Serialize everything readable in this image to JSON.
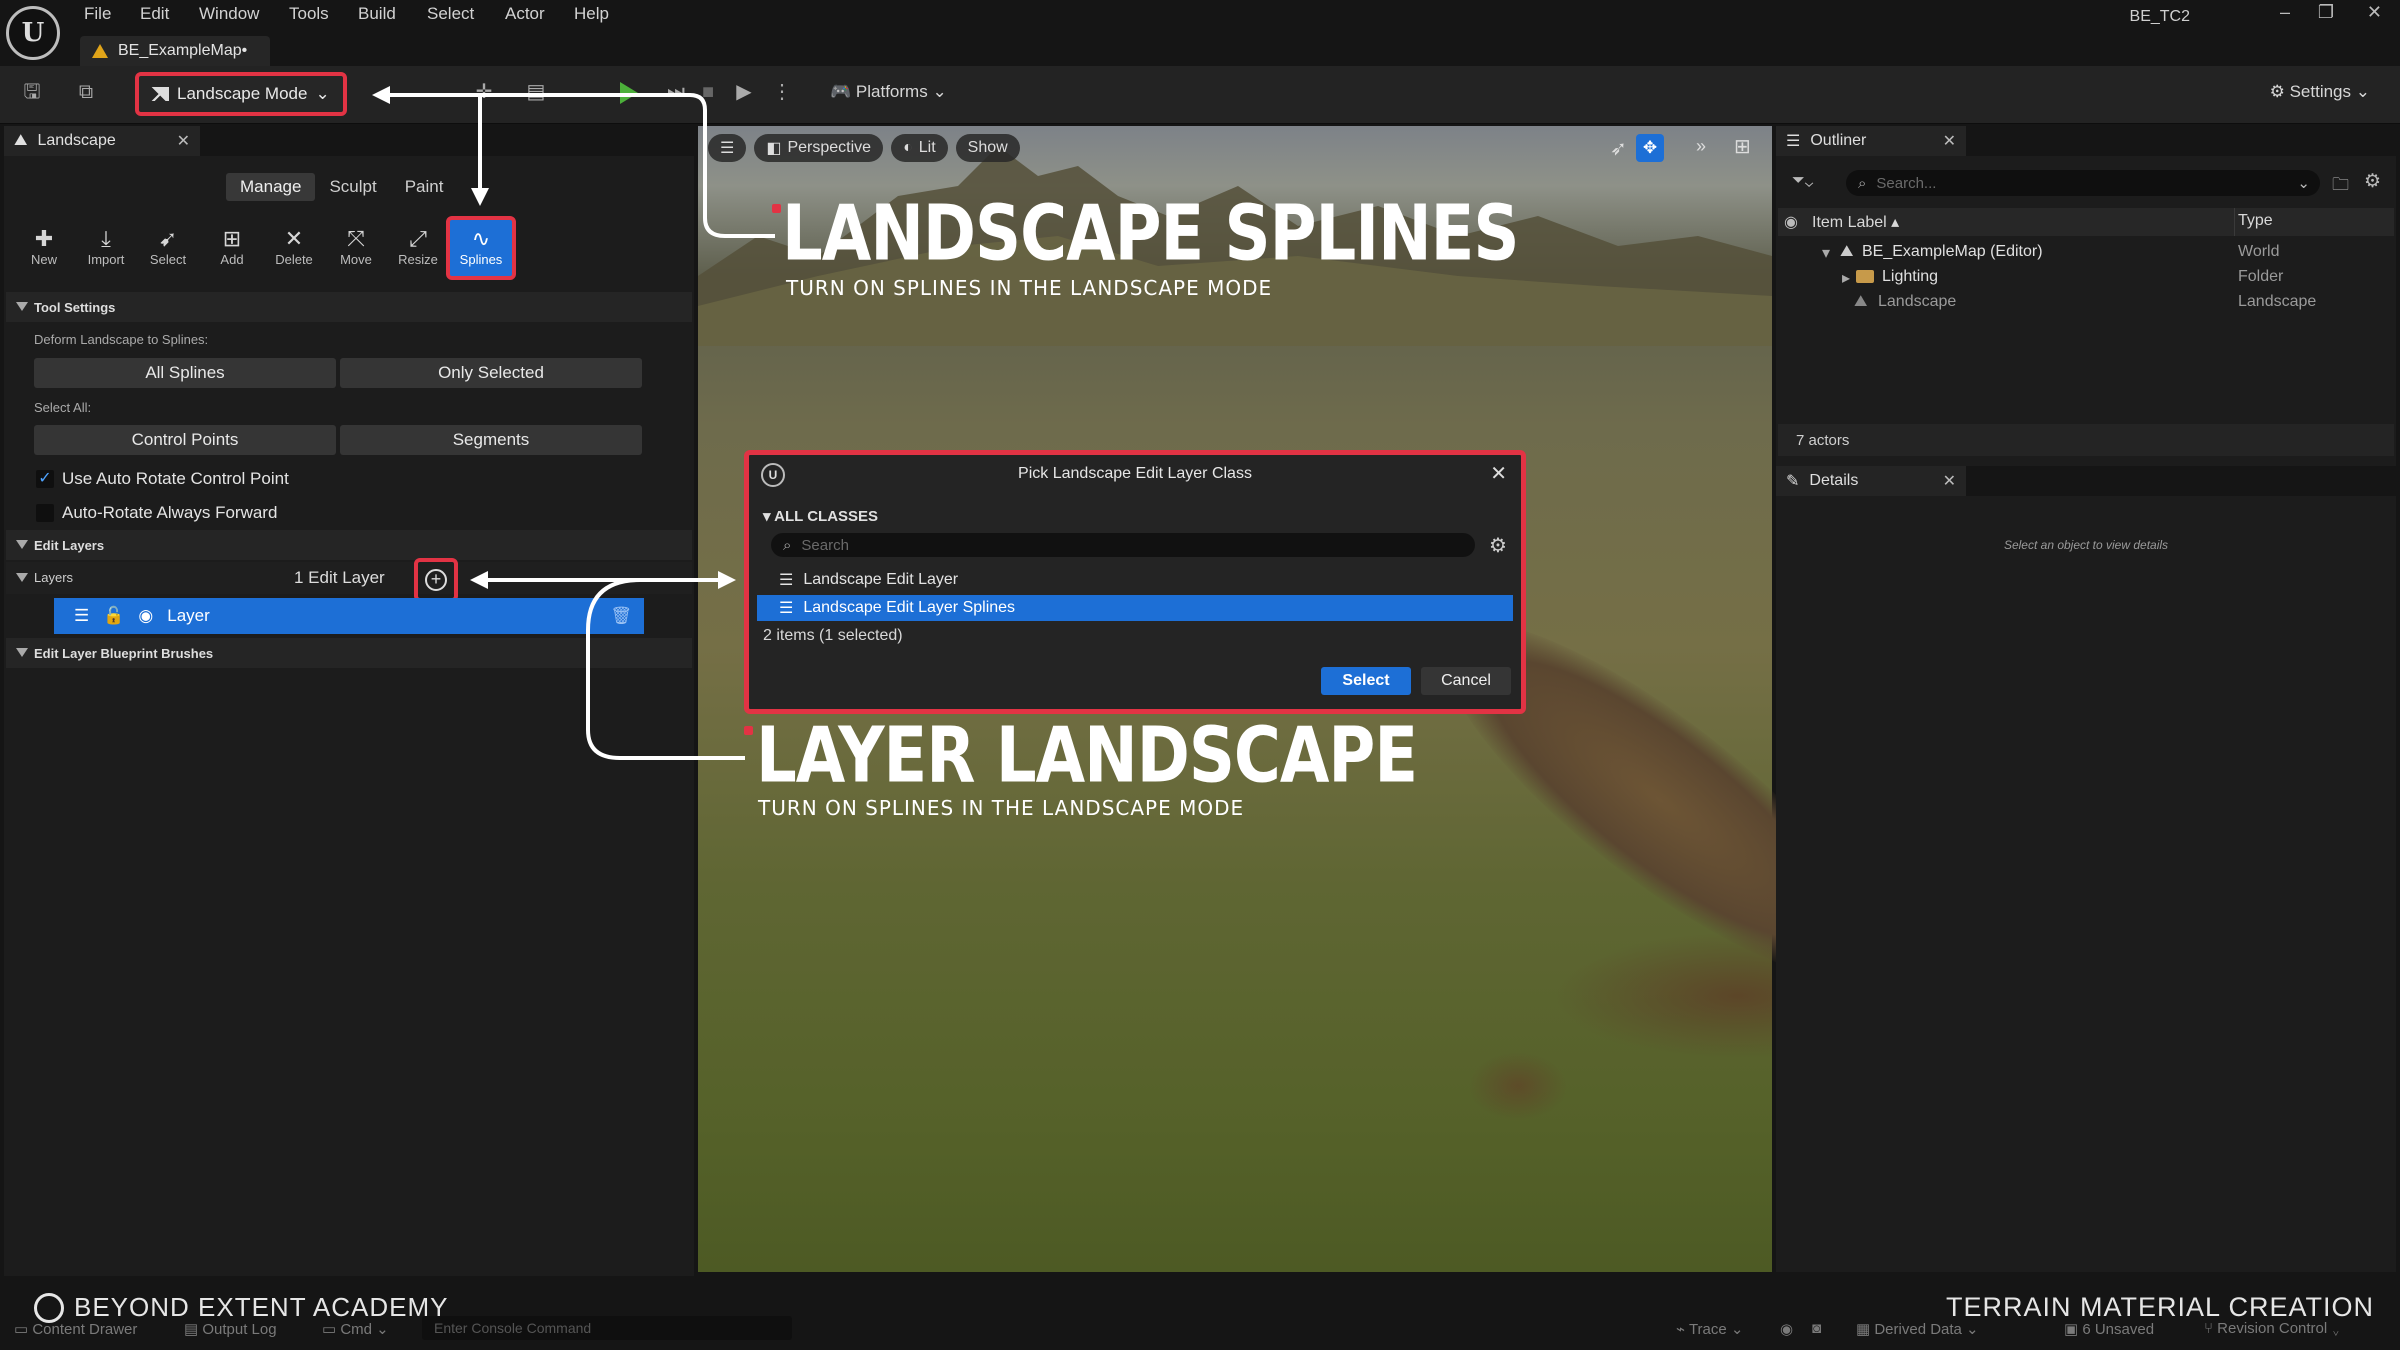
{
  "menu": [
    "File",
    "Edit",
    "Window",
    "Tools",
    "Build",
    "Select",
    "Actor",
    "Help"
  ],
  "project_name": "BE_TC2",
  "map_tab": "BE_ExampleMap•",
  "toolbar": {
    "mode_label": "Landscape Mode",
    "platforms_label": "Platforms",
    "settings_label": "Settings"
  },
  "landscape_panel": {
    "tab_label": "Landscape",
    "mode_tabs": [
      "Manage",
      "Sculpt",
      "Paint"
    ],
    "tools": [
      "New",
      "Import",
      "Select",
      "Add",
      "Delete",
      "Move",
      "Resize",
      "Splines"
    ],
    "tool_settings": {
      "header": "Tool Settings",
      "deform_label": "Deform Landscape to Splines:",
      "all_splines": "All Splines",
      "only_selected": "Only Selected",
      "select_all_label": "Select All:",
      "control_points": "Control Points",
      "segments": "Segments",
      "auto_rotate": "Use Auto Rotate Control Point",
      "auto_rotate_forward": "Auto-Rotate Always Forward",
      "auto_rotate_checked": true,
      "auto_rotate_forward_checked": false
    },
    "edit_layers": {
      "header": "Edit Layers",
      "layers_label": "Layers",
      "count_label": "1 Edit Layer",
      "layer_name": "Layer"
    },
    "blueprint_brushes_header": "Edit Layer Blueprint Brushes"
  },
  "viewport": {
    "perspective": "Perspective",
    "lit": "Lit",
    "show": "Show"
  },
  "annotations": {
    "title1": "LANDSCAPE SPLINES",
    "subtitle1": "TURN ON SPLINES IN THE LANDSCAPE MODE",
    "title2": "LAYER LANDSCAPE",
    "subtitle2": "TURN ON SPLINES IN THE LANDSCAPE MODE"
  },
  "dialog": {
    "title": "Pick Landscape Edit Layer Class",
    "section": "ALL CLASSES",
    "search_placeholder": "Search",
    "items": [
      "Landscape Edit Layer",
      "Landscape Edit Layer Splines"
    ],
    "selected_index": 1,
    "count": "2 items (1 selected)",
    "select_label": "Select",
    "cancel_label": "Cancel"
  },
  "outliner": {
    "tab_label": "Outliner",
    "search_placeholder": "Search...",
    "col_label": "Item Label",
    "col_type": "Type",
    "rows": [
      {
        "label": "BE_ExampleMap (Editor)",
        "type": "World"
      },
      {
        "label": "Lighting",
        "type": "Folder"
      },
      {
        "label": "Landscape",
        "type": "Landscape"
      }
    ],
    "actor_count": "7 actors"
  },
  "details": {
    "tab_label": "Details",
    "hint": "Select an object to view details"
  },
  "statusbar": {
    "content_drawer": "Content Drawer",
    "output_log": "Output Log",
    "cmd": "Cmd",
    "console_placeholder": "Enter Console Command",
    "trace": "Trace",
    "derived_data": "Derived Data",
    "unsaved": "6 Unsaved",
    "revision": "Revision Control"
  },
  "branding": {
    "left": "BEYOND EXTENT ACADEMY",
    "right": "TERRAIN MATERIAL CREATION"
  },
  "colors": {
    "accent_blue": "#1d6fd6",
    "highlight_red": "#e23344",
    "panel_bg": "#1c1c1c"
  }
}
